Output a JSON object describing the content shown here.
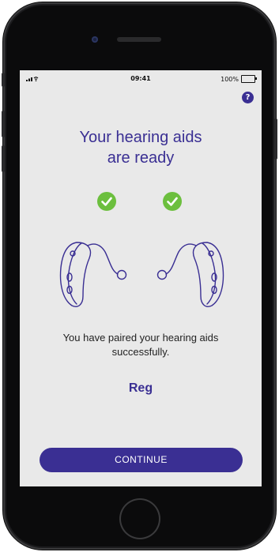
{
  "status_bar": {
    "signal": "▐▐ ≡",
    "time": "09:41",
    "battery": "100%"
  },
  "help_icon": {
    "glyph": "?"
  },
  "screen": {
    "title_line1": "Your hearing aids",
    "title_line2": "are ready",
    "message_line1": "You have paired your hearing aids",
    "message_line2": "successfully.",
    "device_name": "Reg",
    "continue_label": "CONTINUE"
  },
  "colors": {
    "accent": "#3a2f93",
    "check": "#6cbf3e",
    "background": "#e9e9e9"
  },
  "icons": [
    "help-icon",
    "check-icon",
    "hearing-aid-icon",
    "battery-icon",
    "signal-icon",
    "wifi-icon"
  ]
}
